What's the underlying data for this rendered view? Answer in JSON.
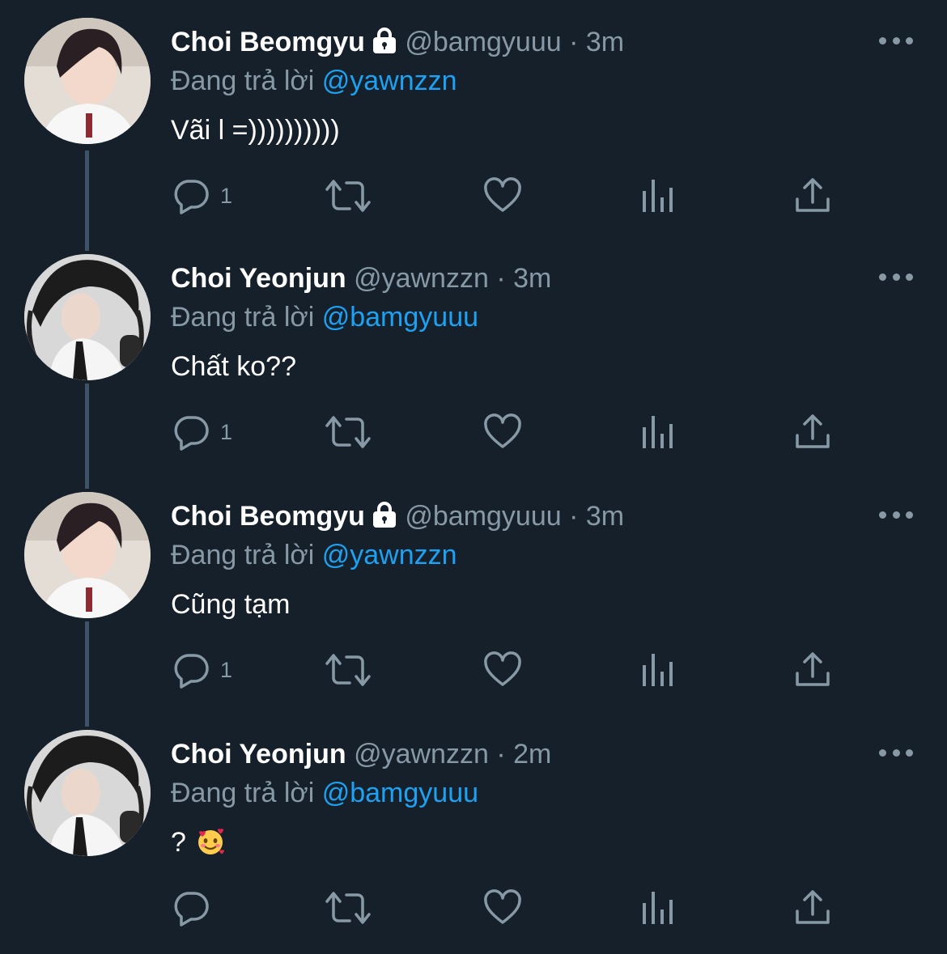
{
  "colors": {
    "background": "#15202b",
    "secondary_text": "#8899a6",
    "accent": "#1da1f2",
    "thread_line": "#3d5466"
  },
  "tweets": [
    {
      "name": "Choi Beomgyu",
      "protected": true,
      "handle": "@bamgyuuu",
      "dot": "·",
      "time": "3m",
      "replying_prefix": "Đang trả lời",
      "replying_to": "@yawnzzn",
      "text": "Vãi l =))))))))))",
      "reply_count": "1",
      "avatar_icon": "avatar-beomgyu"
    },
    {
      "name": "Choi Yeonjun",
      "protected": false,
      "handle": "@yawnzzn",
      "dot": "·",
      "time": "3m",
      "replying_prefix": "Đang trả lời",
      "replying_to": "@bamgyuuu",
      "text": "Chất ko??",
      "reply_count": "1",
      "avatar_icon": "avatar-yeonjun"
    },
    {
      "name": "Choi Beomgyu",
      "protected": true,
      "handle": "@bamgyuuu",
      "dot": "·",
      "time": "3m",
      "replying_prefix": "Đang trả lời",
      "replying_to": "@yawnzzn",
      "text": "Cũng tạm",
      "reply_count": "1",
      "avatar_icon": "avatar-beomgyu"
    },
    {
      "name": "Choi Yeonjun",
      "protected": false,
      "handle": "@yawnzzn",
      "dot": "·",
      "time": "2m",
      "replying_prefix": "Đang trả lời",
      "replying_to": "@bamgyuuu",
      "text": "?",
      "text_emoji": "smiling-face-with-hearts",
      "reply_count": "",
      "avatar_icon": "avatar-yeonjun"
    }
  ],
  "action_icons": [
    "reply-icon",
    "retweet-icon",
    "like-icon",
    "analytics-icon",
    "share-icon"
  ]
}
